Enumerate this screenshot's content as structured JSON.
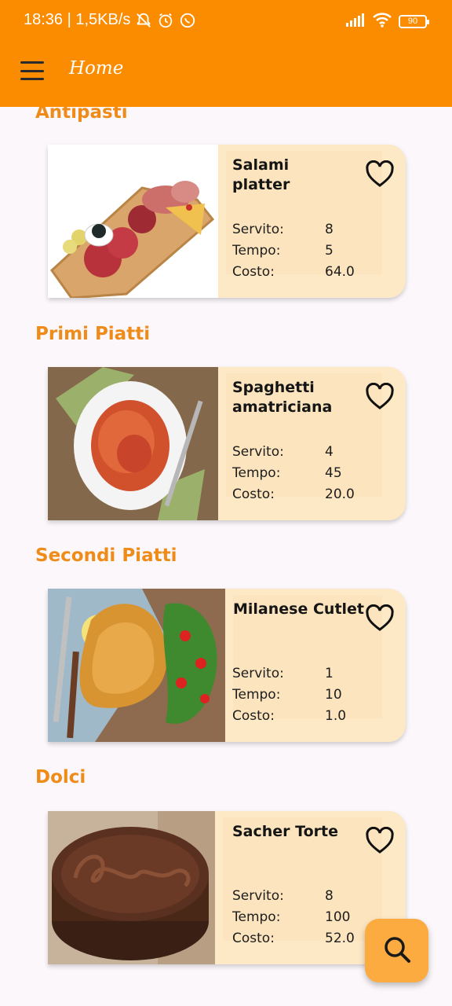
{
  "status_bar": {
    "time_speed": "18:36 | 1,5KB/s",
    "battery": "90"
  },
  "app_bar": {
    "title": "Home"
  },
  "sections": [
    {
      "title": "Antipasti",
      "item": {
        "name": "Salami platter",
        "servito_label": "Servito:",
        "servito": "8",
        "tempo_label": "Tempo:",
        "tempo": "5",
        "costo_label": "Costo:",
        "costo": "64.0"
      }
    },
    {
      "title": "Primi Piatti",
      "item": {
        "name": "Spaghetti amatriciana",
        "servito_label": "Servito:",
        "servito": "4",
        "tempo_label": "Tempo:",
        "tempo": "45",
        "costo_label": "Costo:",
        "costo": "20.0"
      }
    },
    {
      "title": "Secondi Piatti",
      "item": {
        "name": "Milanese Cutlet",
        "servito_label": "Servito:",
        "servito": "1",
        "tempo_label": "Tempo:",
        "tempo": "10",
        "costo_label": "Costo:",
        "costo": "1.0"
      }
    },
    {
      "title": "Dolci",
      "item": {
        "name": "Sacher Torte",
        "servito_label": "Servito:",
        "servito": "8",
        "tempo_label": "Tempo:",
        "tempo": "100",
        "costo_label": "Costo:",
        "costo": "52.0"
      }
    }
  ],
  "icons": {
    "menu": "hamburger-menu-icon",
    "favorite": "heart-outline-icon",
    "search": "search-icon"
  },
  "colors": {
    "app_bar": "#fb8c00",
    "section_title": "#ef8c19",
    "card_background": "#fde9c6",
    "fab": "#fbab3f"
  }
}
